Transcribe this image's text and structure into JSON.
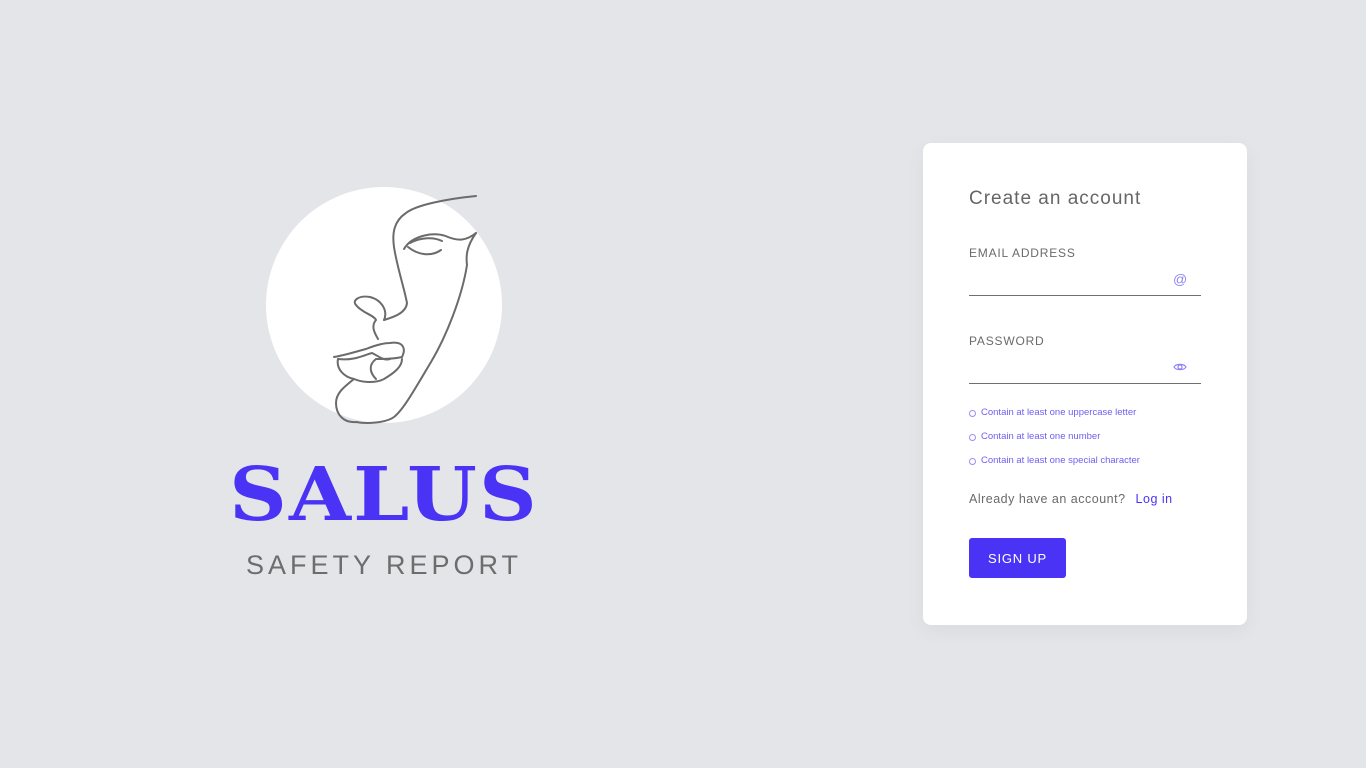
{
  "brand": {
    "name": "SALUS",
    "subtitle": "SAFETY REPORT",
    "logo_icon": "line-art-face-logo"
  },
  "signup": {
    "title": "Create an account",
    "email": {
      "label": "EMAIL ADDRESS",
      "value": "",
      "icon": "at-icon",
      "icon_glyph": "@"
    },
    "password": {
      "label": "PASSWORD",
      "value": "",
      "icon": "eye-icon"
    },
    "rules": [
      "Contain at least one uppercase letter",
      "Contain at least one number",
      "Contain at least one special character"
    ],
    "login_prompt": "Already have an account?",
    "login_link": "Log in",
    "submit_label": "SIGN UP"
  },
  "colors": {
    "background": "#e4e5e9",
    "accent": "#4b33f5",
    "card": "#ffffff",
    "text_muted": "#6a6a6a"
  }
}
